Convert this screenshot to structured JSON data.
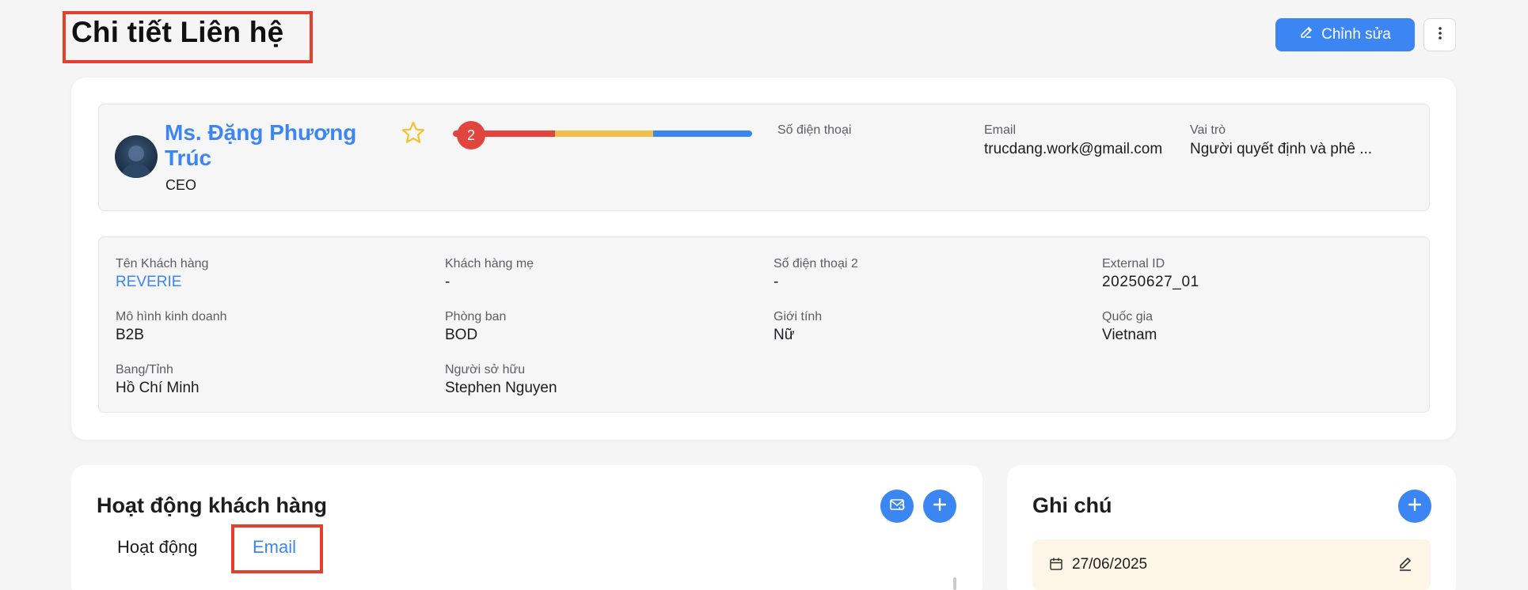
{
  "header": {
    "title": "Chi tiết Liên hệ",
    "edit_label": "Chỉnh sửa"
  },
  "profile": {
    "name": "Ms. Đặng Phương Trúc",
    "title": "CEO",
    "stage_badge": "2",
    "stage_progress_colors": [
      "#e2443e",
      "#f0c04a",
      "#3b86f3"
    ],
    "fields": {
      "phone_label": "Số điện thoại",
      "phone_value": "",
      "email_label": "Email",
      "email_value": "trucdang.work@gmail.com",
      "role_label": "Vai trò",
      "role_value": "Người quyết định và phê ..."
    }
  },
  "details": {
    "customer_name_label": "Tên Khách hàng",
    "customer_name_value": "REVERIE",
    "parent_customer_label": "Khách hàng mẹ",
    "parent_customer_value": "-",
    "phone2_label": "Số điện thoại 2",
    "phone2_value": "-",
    "external_id_label": "External ID",
    "external_id_value": "20250627_01",
    "business_model_label": "Mô hình kinh doanh",
    "business_model_value": "B2B",
    "department_label": "Phòng ban",
    "department_value": "BOD",
    "gender_label": "Giới tính",
    "gender_value": "Nữ",
    "country_label": "Quốc gia",
    "country_value": "Vietnam",
    "state_label": "Bang/Tỉnh",
    "state_value": "Hồ Chí Minh",
    "owner_label": "Người sở hữu",
    "owner_value": "Stephen Nguyen"
  },
  "activity": {
    "title": "Hoạt động khách hàng",
    "tabs": [
      {
        "label": "Hoạt động"
      },
      {
        "label": "Email"
      }
    ]
  },
  "notes": {
    "title": "Ghi chú",
    "items": [
      {
        "date": "27/06/2025"
      }
    ]
  },
  "colors": {
    "accent": "#3b86f3",
    "highlight_box": "#e3402d",
    "note_bg": "#fdf6e6"
  }
}
